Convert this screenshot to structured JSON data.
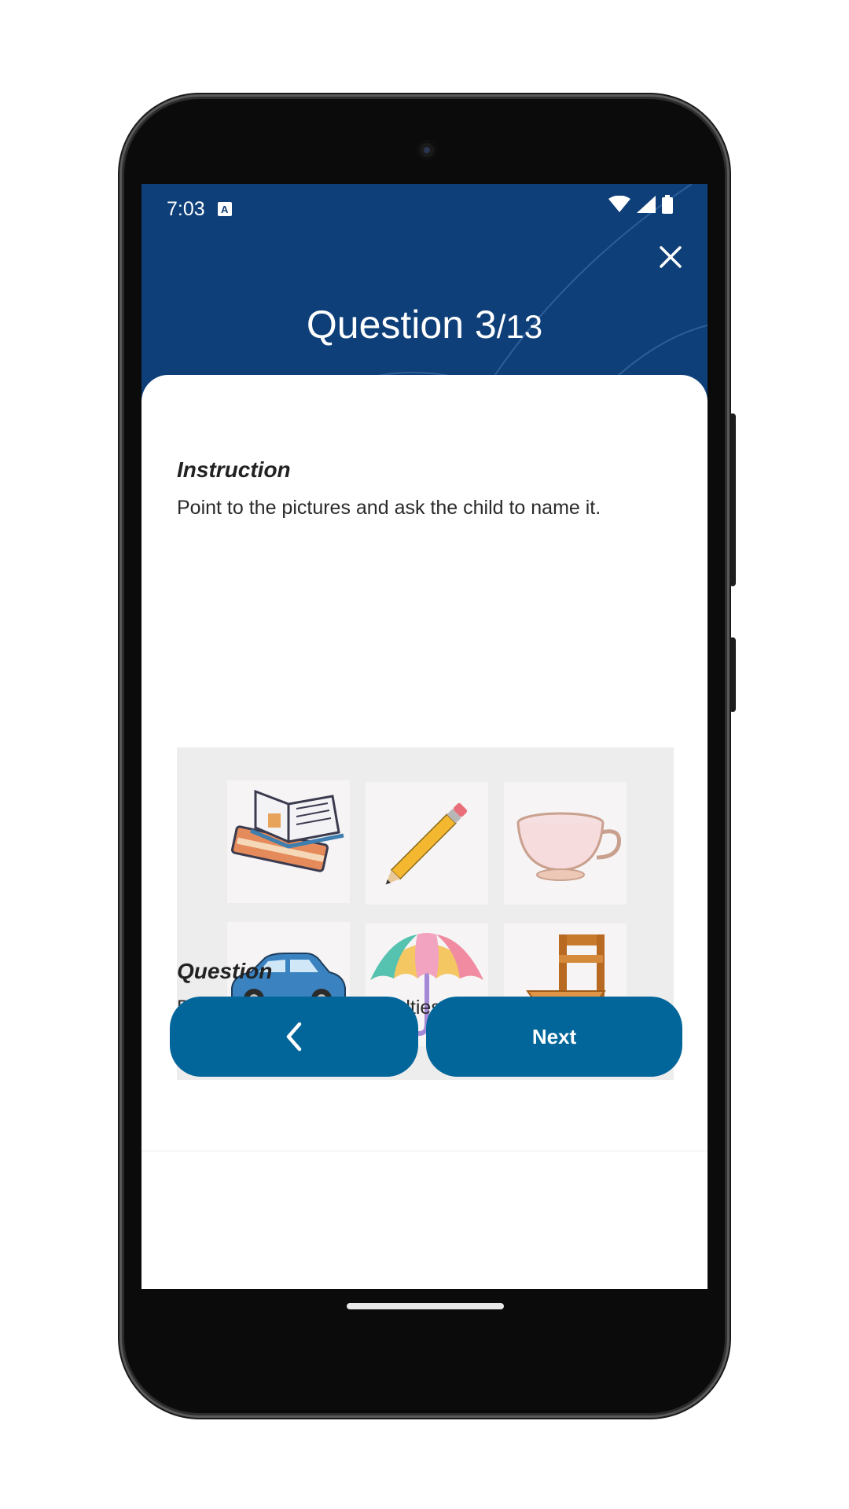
{
  "status_bar": {
    "time": "7:03",
    "notification_badge": "A",
    "icons": [
      "wifi-icon",
      "cellular-signal-icon",
      "battery-icon"
    ]
  },
  "header": {
    "title_main": "Question 3",
    "title_suffix": "/13",
    "close_icon": "close-icon",
    "background_color": "#0e3f78"
  },
  "instruction": {
    "label": "Instruction",
    "text": "Point to the pictures and ask the child to name it."
  },
  "pictures": [
    {
      "name": "books",
      "icon": "books-icon"
    },
    {
      "name": "pencil",
      "icon": "pencil-icon"
    },
    {
      "name": "teacup",
      "icon": "teacup-icon"
    },
    {
      "name": "car",
      "icon": "car-icon"
    },
    {
      "name": "umbrella",
      "icon": "umbrella-icon"
    },
    {
      "name": "chair",
      "icon": "chair-icon"
    }
  ],
  "question": {
    "label": "Question",
    "text": "Does the child have difficulties in rapidly naming the pictures?"
  },
  "navigation": {
    "back_icon": "chevron-left-icon",
    "next_label": "Next",
    "button_color": "#03669a"
  }
}
